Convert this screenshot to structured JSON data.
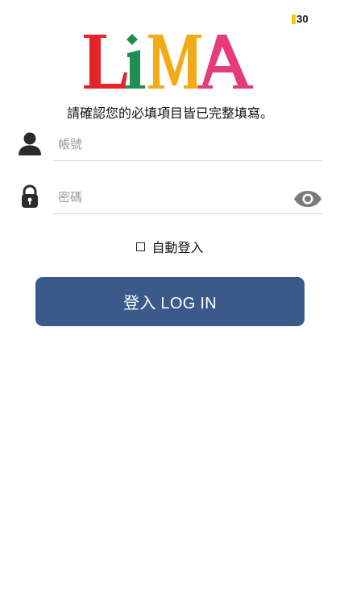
{
  "status": {
    "time_fragment": "30",
    "battery_color": "#f6c800"
  },
  "logo": {
    "text": "LiMA",
    "colors": {
      "L": "#e4232a",
      "i": "#1f8f4f",
      "M": "#f2ab16",
      "A": "#e63b7a"
    }
  },
  "notice": "請確認您的必填項目皆已完整填寫。",
  "username": {
    "placeholder": "帳號",
    "value": "",
    "icon": "person-icon"
  },
  "password": {
    "placeholder": "密碼",
    "value": "",
    "icon": "lock-icon",
    "toggle_icon": "eye-icon"
  },
  "auto_login": {
    "label": "自動登入",
    "checked": false
  },
  "login_button": {
    "label": "登入 LOG IN",
    "color": "#3a5a8c"
  }
}
